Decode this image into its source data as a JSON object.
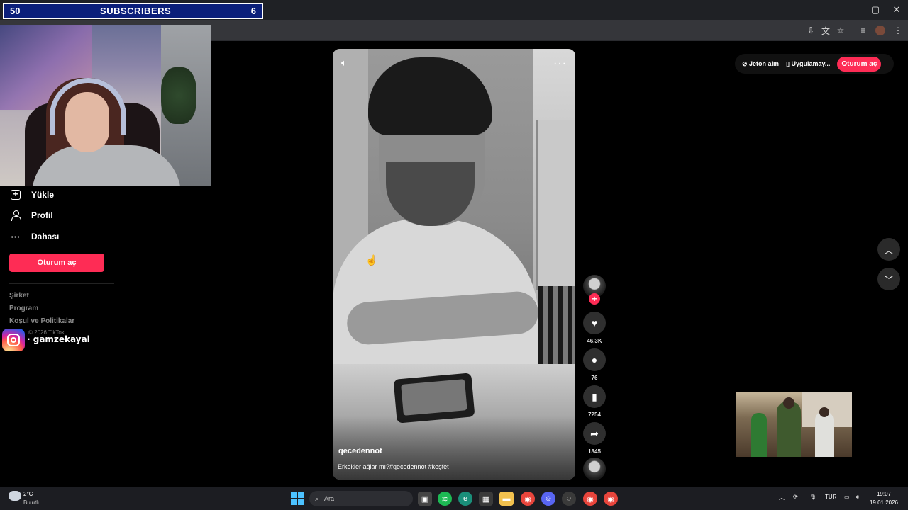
{
  "overlay": {
    "subscriber_goal": {
      "left_count": "50",
      "label": "SUBSCRIBERS",
      "right_count": "6"
    },
    "instagram_handle": "· gamzekayal"
  },
  "window": {
    "minimize": "–",
    "maximize": "▢",
    "close": "✕"
  },
  "toolbar_icons": [
    "install-icon",
    "translate-icon",
    "star-icon",
    "reading-list-icon",
    "profile-icon",
    "menu-icon"
  ],
  "sidebar": {
    "items": [
      {
        "label": "Yükle",
        "icon": "upload-icon"
      },
      {
        "label": "Profil",
        "icon": "profile-icon"
      },
      {
        "label": "Dahası",
        "icon": "more-icon"
      }
    ],
    "login_button": "Oturum aç",
    "footer_links": [
      "Şirket",
      "Program",
      "Koşul ve Politikalar"
    ],
    "copyright": "© 2026 TikTok"
  },
  "top_pills": {
    "coins": "Jeton alın",
    "app": "Uygulamay...",
    "login": "Oturum aç"
  },
  "video": {
    "username": "qecedennot",
    "caption": "Erkekler ağlar mı?#qecedennot #keşfet",
    "likes": "46.3K",
    "comments": "76",
    "saves": "7254",
    "shares": "1845"
  },
  "taskbar": {
    "weather_temp": "2°C",
    "weather_desc": "Bulutlu",
    "search_placeholder": "Ara",
    "language": "TUR",
    "time": "19:07",
    "date": "19.01.2026"
  },
  "colors": {
    "brand": "#fe2c55",
    "overlay_blue": "#0b1f7a",
    "start_blue": "#4cc2ff"
  }
}
